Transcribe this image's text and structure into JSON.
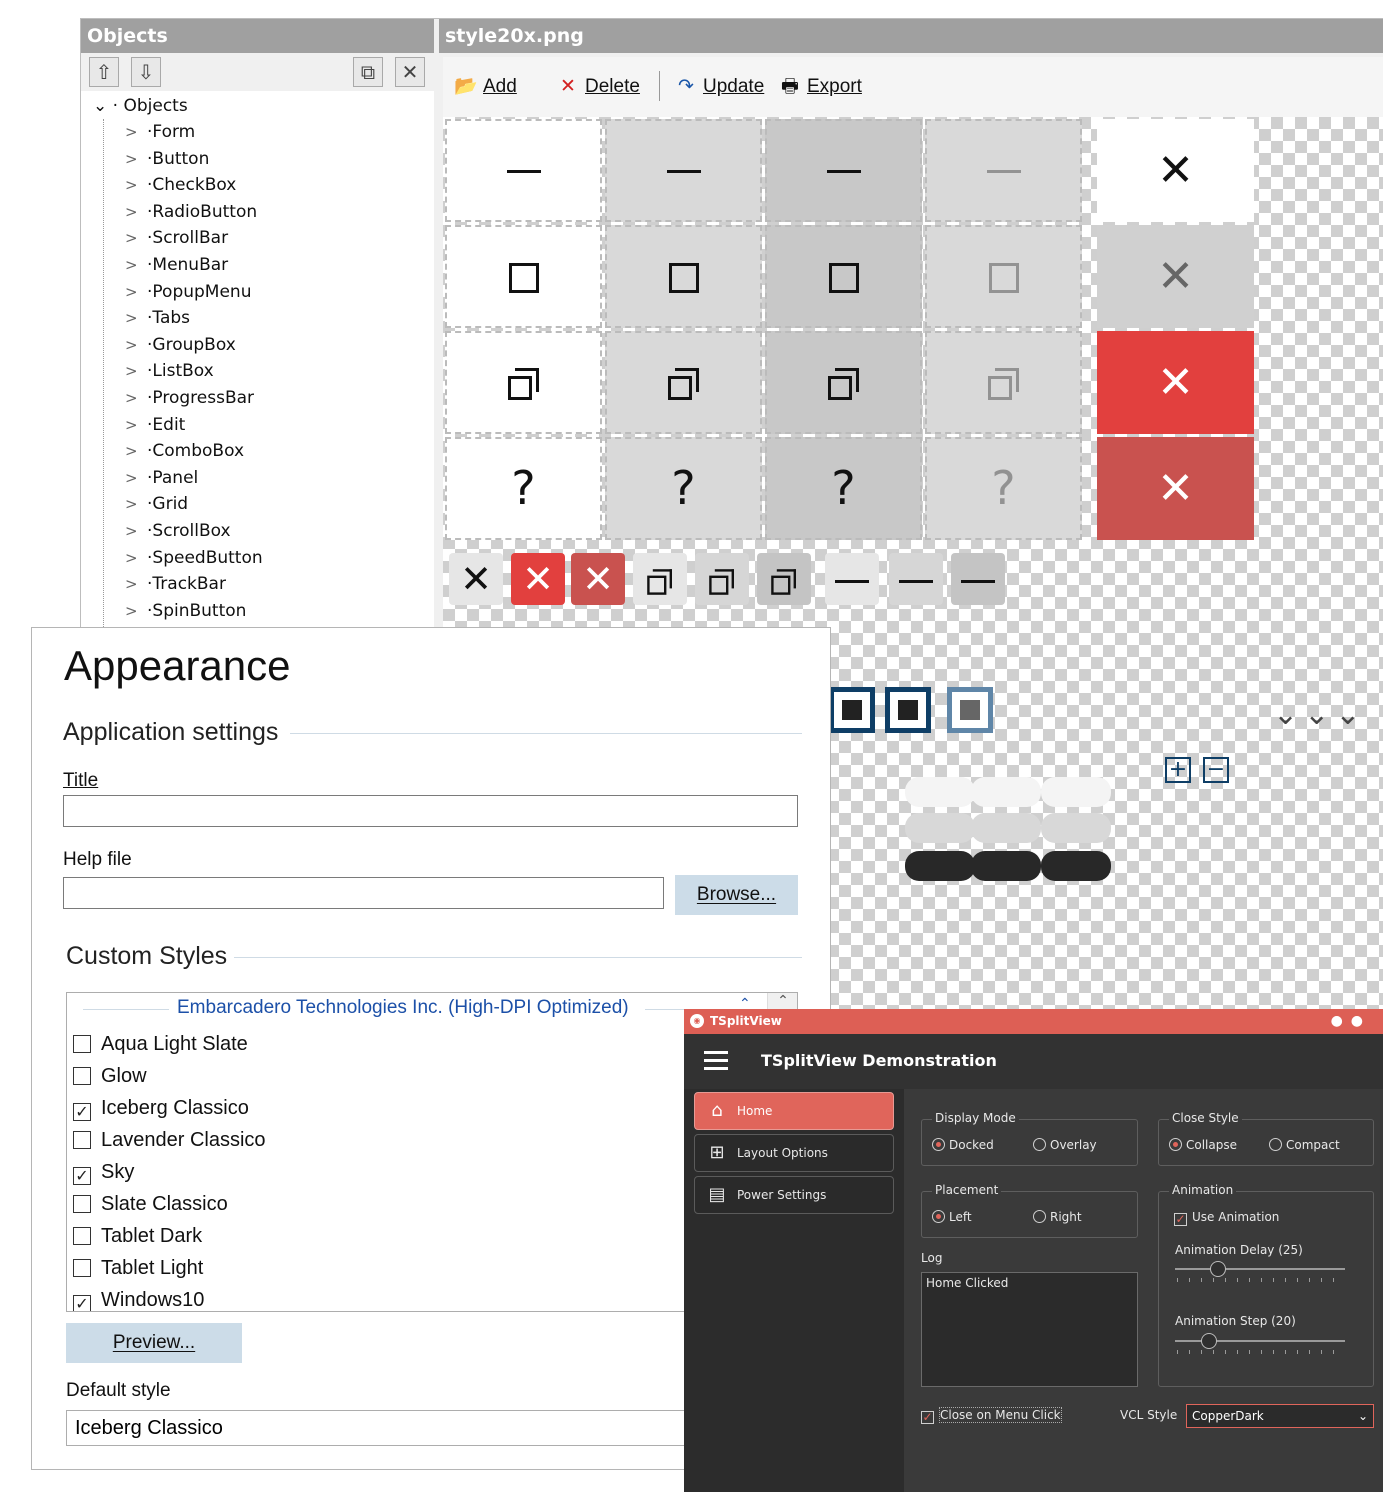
{
  "designer": {
    "objects_title": "Objects",
    "image_title": "style20x.png",
    "tree_root": "Objects",
    "tree_items": [
      "Form",
      "Button",
      "CheckBox",
      "RadioButton",
      "ScrollBar",
      "MenuBar",
      "PopupMenu",
      "Tabs",
      "GroupBox",
      "ListBox",
      "ProgressBar",
      "Edit",
      "ComboBox",
      "Panel",
      "Grid",
      "ScrollBox",
      "SpeedButton",
      "TrackBar",
      "SpinButton"
    ],
    "toolbar": {
      "add": "Add",
      "delete": "Delete",
      "update": "Update",
      "export": "Export"
    },
    "canvas_glyphs": {
      "help": "?",
      "close": "✕"
    },
    "colors": {
      "close_hot": "#e2403e",
      "close_pressed": "#c9524f",
      "title_bar": "#a0a0a0"
    }
  },
  "appearance": {
    "heading": "Appearance",
    "app_settings_label": "Application settings",
    "title_label": "Title",
    "title_value": "",
    "help_file_label": "Help file",
    "help_file_value": "",
    "browse_button": "Browse...",
    "custom_styles_label": "Custom Styles",
    "styles_group_header": "Embarcadero Technologies Inc. (High-DPI Optimized)",
    "styles": [
      {
        "name": "Aqua Light Slate",
        "checked": false
      },
      {
        "name": "Glow",
        "checked": false
      },
      {
        "name": "Iceberg Classico",
        "checked": true
      },
      {
        "name": "Lavender Classico",
        "checked": false
      },
      {
        "name": "Sky",
        "checked": true
      },
      {
        "name": "Slate Classico",
        "checked": false
      },
      {
        "name": "Tablet Dark",
        "checked": false
      },
      {
        "name": "Tablet Light",
        "checked": false
      },
      {
        "name": "Windows10",
        "checked": true
      }
    ],
    "preview_button": "Preview...",
    "default_style_label": "Default style",
    "default_style_value": "Iceberg Classico"
  },
  "splitview": {
    "window_title": "TSplitView",
    "header_title": "TSplitView Demonstration",
    "nav": [
      {
        "label": "Home",
        "icon": "home-icon",
        "active": true
      },
      {
        "label": "Layout Options",
        "icon": "layout-icon",
        "active": false
      },
      {
        "label": "Power Settings",
        "icon": "battery-icon",
        "active": false
      }
    ],
    "display_mode": {
      "title": "Display Mode",
      "options": [
        "Docked",
        "Overlay"
      ],
      "selected": "Docked"
    },
    "close_style": {
      "title": "Close Style",
      "options": [
        "Collapse",
        "Compact"
      ],
      "selected": "Collapse"
    },
    "placement": {
      "title": "Placement",
      "options": [
        "Left",
        "Right"
      ],
      "selected": "Left"
    },
    "animation": {
      "title": "Animation",
      "use_animation_label": "Use Animation",
      "use_animation": true,
      "delay_label": "Animation Delay (25)",
      "delay": 25,
      "step_label": "Animation Step (20)",
      "step": 20
    },
    "log_label": "Log",
    "log_text": "Home Clicked",
    "close_on_menu_click_label": "Close on Menu Click",
    "close_on_menu_click": true,
    "vcl_style_label": "VCL Style",
    "vcl_style_value": "CopperDark",
    "colors": {
      "accent": "#e0655b",
      "background": "#3a3a3a",
      "pane": "#2c2c2c"
    }
  }
}
